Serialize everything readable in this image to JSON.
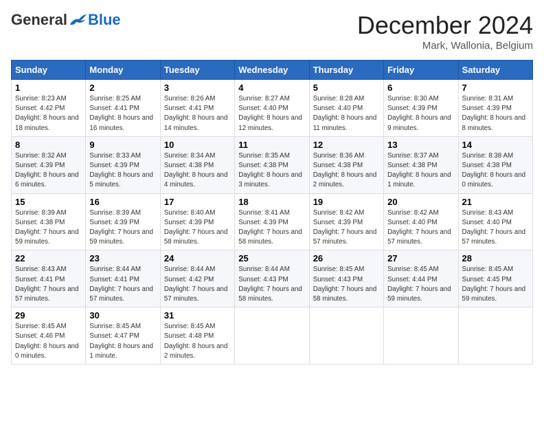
{
  "logo": {
    "general": "General",
    "blue": "Blue"
  },
  "title": "December 2024",
  "location": "Mark, Wallonia, Belgium",
  "days_of_week": [
    "Sunday",
    "Monday",
    "Tuesday",
    "Wednesday",
    "Thursday",
    "Friday",
    "Saturday"
  ],
  "weeks": [
    [
      {
        "day": "1",
        "sunrise": "8:23 AM",
        "sunset": "4:42 PM",
        "daylight": "8 hours and 18 minutes."
      },
      {
        "day": "2",
        "sunrise": "8:25 AM",
        "sunset": "4:41 PM",
        "daylight": "8 hours and 16 minutes."
      },
      {
        "day": "3",
        "sunrise": "8:26 AM",
        "sunset": "4:41 PM",
        "daylight": "8 hours and 14 minutes."
      },
      {
        "day": "4",
        "sunrise": "8:27 AM",
        "sunset": "4:40 PM",
        "daylight": "8 hours and 12 minutes."
      },
      {
        "day": "5",
        "sunrise": "8:28 AM",
        "sunset": "4:40 PM",
        "daylight": "8 hours and 11 minutes."
      },
      {
        "day": "6",
        "sunrise": "8:30 AM",
        "sunset": "4:39 PM",
        "daylight": "8 hours and 9 minutes."
      },
      {
        "day": "7",
        "sunrise": "8:31 AM",
        "sunset": "4:39 PM",
        "daylight": "8 hours and 8 minutes."
      }
    ],
    [
      {
        "day": "8",
        "sunrise": "8:32 AM",
        "sunset": "4:39 PM",
        "daylight": "8 hours and 6 minutes."
      },
      {
        "day": "9",
        "sunrise": "8:33 AM",
        "sunset": "4:39 PM",
        "daylight": "8 hours and 5 minutes."
      },
      {
        "day": "10",
        "sunrise": "8:34 AM",
        "sunset": "4:38 PM",
        "daylight": "8 hours and 4 minutes."
      },
      {
        "day": "11",
        "sunrise": "8:35 AM",
        "sunset": "4:38 PM",
        "daylight": "8 hours and 3 minutes."
      },
      {
        "day": "12",
        "sunrise": "8:36 AM",
        "sunset": "4:38 PM",
        "daylight": "8 hours and 2 minutes."
      },
      {
        "day": "13",
        "sunrise": "8:37 AM",
        "sunset": "4:38 PM",
        "daylight": "8 hours and 1 minute."
      },
      {
        "day": "14",
        "sunrise": "8:38 AM",
        "sunset": "4:38 PM",
        "daylight": "8 hours and 0 minutes."
      }
    ],
    [
      {
        "day": "15",
        "sunrise": "8:39 AM",
        "sunset": "4:38 PM",
        "daylight": "7 hours and 59 minutes."
      },
      {
        "day": "16",
        "sunrise": "8:39 AM",
        "sunset": "4:39 PM",
        "daylight": "7 hours and 59 minutes."
      },
      {
        "day": "17",
        "sunrise": "8:40 AM",
        "sunset": "4:39 PM",
        "daylight": "7 hours and 58 minutes."
      },
      {
        "day": "18",
        "sunrise": "8:41 AM",
        "sunset": "4:39 PM",
        "daylight": "7 hours and 58 minutes."
      },
      {
        "day": "19",
        "sunrise": "8:42 AM",
        "sunset": "4:39 PM",
        "daylight": "7 hours and 57 minutes."
      },
      {
        "day": "20",
        "sunrise": "8:42 AM",
        "sunset": "4:40 PM",
        "daylight": "7 hours and 57 minutes."
      },
      {
        "day": "21",
        "sunrise": "8:43 AM",
        "sunset": "4:40 PM",
        "daylight": "7 hours and 57 minutes."
      }
    ],
    [
      {
        "day": "22",
        "sunrise": "8:43 AM",
        "sunset": "4:41 PM",
        "daylight": "7 hours and 57 minutes."
      },
      {
        "day": "23",
        "sunrise": "8:44 AM",
        "sunset": "4:41 PM",
        "daylight": "7 hours and 57 minutes."
      },
      {
        "day": "24",
        "sunrise": "8:44 AM",
        "sunset": "4:42 PM",
        "daylight": "7 hours and 57 minutes."
      },
      {
        "day": "25",
        "sunrise": "8:44 AM",
        "sunset": "4:43 PM",
        "daylight": "7 hours and 58 minutes."
      },
      {
        "day": "26",
        "sunrise": "8:45 AM",
        "sunset": "4:43 PM",
        "daylight": "7 hours and 58 minutes."
      },
      {
        "day": "27",
        "sunrise": "8:45 AM",
        "sunset": "4:44 PM",
        "daylight": "7 hours and 59 minutes."
      },
      {
        "day": "28",
        "sunrise": "8:45 AM",
        "sunset": "4:45 PM",
        "daylight": "7 hours and 59 minutes."
      }
    ],
    [
      {
        "day": "29",
        "sunrise": "8:45 AM",
        "sunset": "4:46 PM",
        "daylight": "8 hours and 0 minutes."
      },
      {
        "day": "30",
        "sunrise": "8:45 AM",
        "sunset": "4:47 PM",
        "daylight": "8 hours and 1 minute."
      },
      {
        "day": "31",
        "sunrise": "8:45 AM",
        "sunset": "4:48 PM",
        "daylight": "8 hours and 2 minutes."
      },
      null,
      null,
      null,
      null
    ]
  ]
}
